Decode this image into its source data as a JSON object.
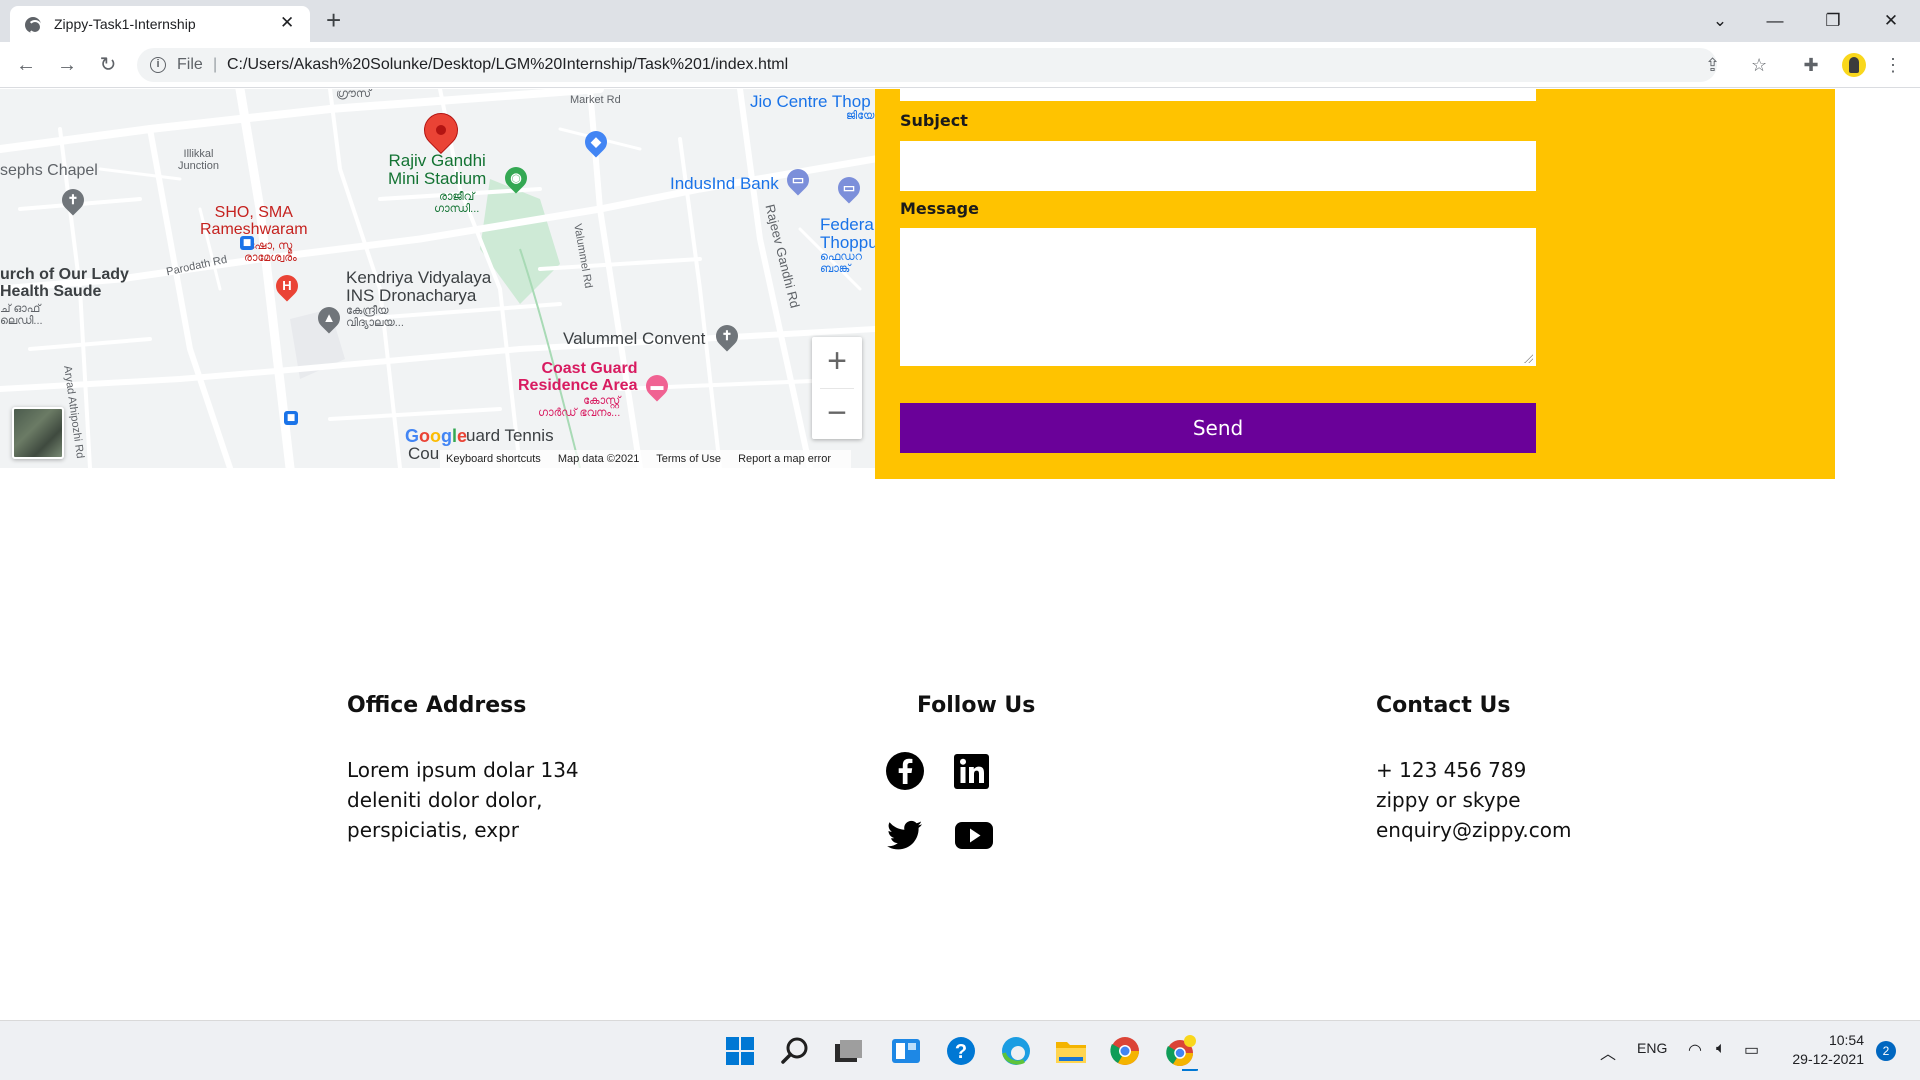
{
  "browser": {
    "tab_title": "Zippy-Task1-Internship",
    "tab_close": "✕",
    "new_tab": "+",
    "scheme_label": "File",
    "url": "C:/Users/Akash%20Solunke/Desktop/LGM%20Internship/Task%201/index.html"
  },
  "map": {
    "labels": {
      "market_rd": "Market Rd",
      "jio_centre": "Jio Centre Thop",
      "jio_ml": "ജിയോ",
      "illikkal": "Illikkal\nJunction",
      "chapel": "sephs Chapel",
      "stadium": "Rajiv Gandhi\nMini Stadium",
      "stadium_ml": "രാജീവ്\nഗാന്ധി...",
      "indusind": "IndusInd Bank",
      "federal": "Federa\nThoppu",
      "federal_ml": "ഫെഡറ\nബാങ്ക്",
      "sho": "SHO, SMA\nRameshwaram",
      "sho_ml": "ഷോ, സ്മ\nരാമേശ്വരം",
      "church": "urch of Our Lady\nHealth Saude",
      "church_ml": "ച് ഓഫ്\nലെഡി...",
      "parodath": "Parodath Rd",
      "kendriya": "Kendriya Vidyalaya\nINS Dronacharya",
      "kendriya_ml": "കേന്ദ്രീയ\nവിദ്യാലയ...",
      "valummel_rd": "Valummel Rd",
      "rajeev_rd": "Rajeev Gandhi Rd",
      "convent": "Valummel Convent",
      "coast_guard": "Coast Guard\nResidence Area",
      "coast_guard_ml": "കോസ്റ്റ്\nഗാർഡ് ഭവനം...",
      "tennis": "uard Tennis",
      "cou": "Cou",
      "arya_rd": "Aryad Athipozhi Rd",
      "top_ml": "ഗ്രൗസ്"
    },
    "google_logo": "Google",
    "zoom_in": "+",
    "zoom_out": "−",
    "footer": {
      "shortcuts": "Keyboard shortcuts",
      "map_data": "Map data ©2021",
      "terms": "Terms of Use",
      "report": "Report a map error"
    }
  },
  "form": {
    "subject_label": "Subject",
    "message_label": "Message",
    "subject_value": "",
    "message_value": "",
    "send_label": "Send"
  },
  "footer": {
    "office": {
      "heading": "Office Address",
      "lines": [
        "Lorem ipsum dolar 134",
        "deleniti dolor dolor,",
        "perspiciatis, expr"
      ]
    },
    "follow": {
      "heading": "Follow Us",
      "icons": [
        "facebook-icon",
        "linkedin-icon",
        "twitter-icon",
        "youtube-icon"
      ]
    },
    "contact": {
      "heading": "Contact Us",
      "lines": [
        "+ 123 456 789",
        "zippy or skype",
        "enquiry@zippy.com"
      ]
    }
  },
  "taskbar": {
    "language": "ENG",
    "time": "10:54",
    "date": "29-12-2021",
    "notification_count": "2"
  },
  "colors": {
    "form_background": "#ffc300",
    "send_button": "#6a0199",
    "taskbar": "#eef0f3"
  }
}
